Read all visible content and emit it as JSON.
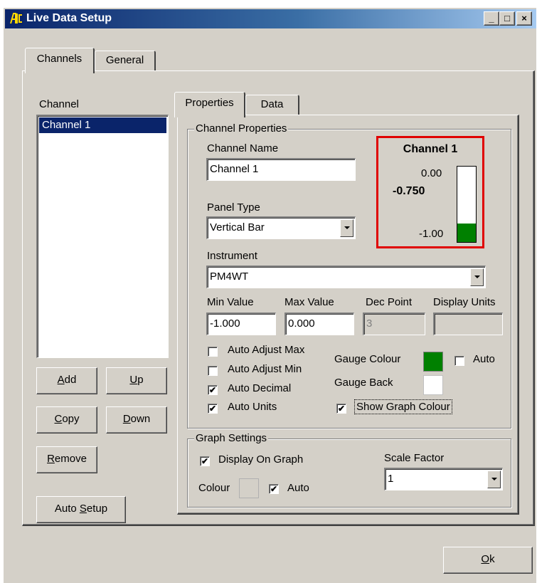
{
  "window": {
    "title": "Live Data Setup",
    "controls": {
      "minimize": "_",
      "maximize": "□",
      "close": "×"
    }
  },
  "main_tabs": [
    {
      "label": "Channels",
      "active": true
    },
    {
      "label": "General",
      "active": false
    }
  ],
  "channel_list": {
    "label": "Channel",
    "items": [
      "Channel 1"
    ],
    "selected_index": 0
  },
  "left_buttons": {
    "add": {
      "underline": "A",
      "rest": "dd"
    },
    "up": {
      "underline": "U",
      "rest": "p"
    },
    "copy": {
      "underline": "C",
      "rest": "opy"
    },
    "down": {
      "underline": "D",
      "rest": "own"
    },
    "remove": {
      "underline": "R",
      "rest": "emove"
    },
    "auto_setup": {
      "before": "Auto ",
      "underline": "S",
      "rest": "etup"
    }
  },
  "sub_tabs": [
    {
      "label": "Properties",
      "active": true
    },
    {
      "label": "Data",
      "active": false
    }
  ],
  "channel_properties": {
    "group_label": "Channel Properties",
    "channel_name_label": "Channel Name",
    "channel_name_value": "Channel 1",
    "panel_type_label": "Panel Type",
    "panel_type_value": "Vertical Bar",
    "instrument_label": "Instrument",
    "instrument_value": "PM4WT",
    "min_value_label": "Min Value",
    "min_value": "-1.000",
    "max_value_label": "Max Value",
    "max_value": "0.000",
    "dec_point_label": "Dec Point",
    "dec_point_value": "3",
    "display_units_label": "Display Units",
    "display_units_value": "",
    "checkboxes": [
      {
        "label": "Auto Adjust Max",
        "checked": false
      },
      {
        "label": "Auto Adjust Min",
        "checked": false
      },
      {
        "label": "Auto Decimal",
        "checked": true
      },
      {
        "label": "Auto Units",
        "checked": true
      }
    ],
    "gauge_colour_label": "Gauge Colour",
    "gauge_colour": "#008000",
    "gauge_auto_label": "Auto",
    "gauge_auto_checked": false,
    "gauge_back_label": "Gauge Back",
    "gauge_back_colour": "#ffffff",
    "show_graph_colour_label": "Show Graph Colour",
    "show_graph_colour_checked": true
  },
  "preview": {
    "title": "Channel 1",
    "max_label": "0.00",
    "min_label": "-1.00",
    "current_value": "-0.750",
    "fill_fraction": 0.25,
    "fill_colour": "#008000",
    "border_colour": "#e00000"
  },
  "graph_settings": {
    "group_label": "Graph Settings",
    "display_on_graph_label": "Display On Graph",
    "display_on_graph_checked": true,
    "colour_label": "Colour",
    "colour_auto_label": "Auto",
    "colour_auto_checked": true,
    "scale_factor_label": "Scale Factor",
    "scale_factor_value": "1"
  },
  "footer": {
    "ok": {
      "underline": "O",
      "rest": "k"
    }
  },
  "check_glyph": "✔"
}
